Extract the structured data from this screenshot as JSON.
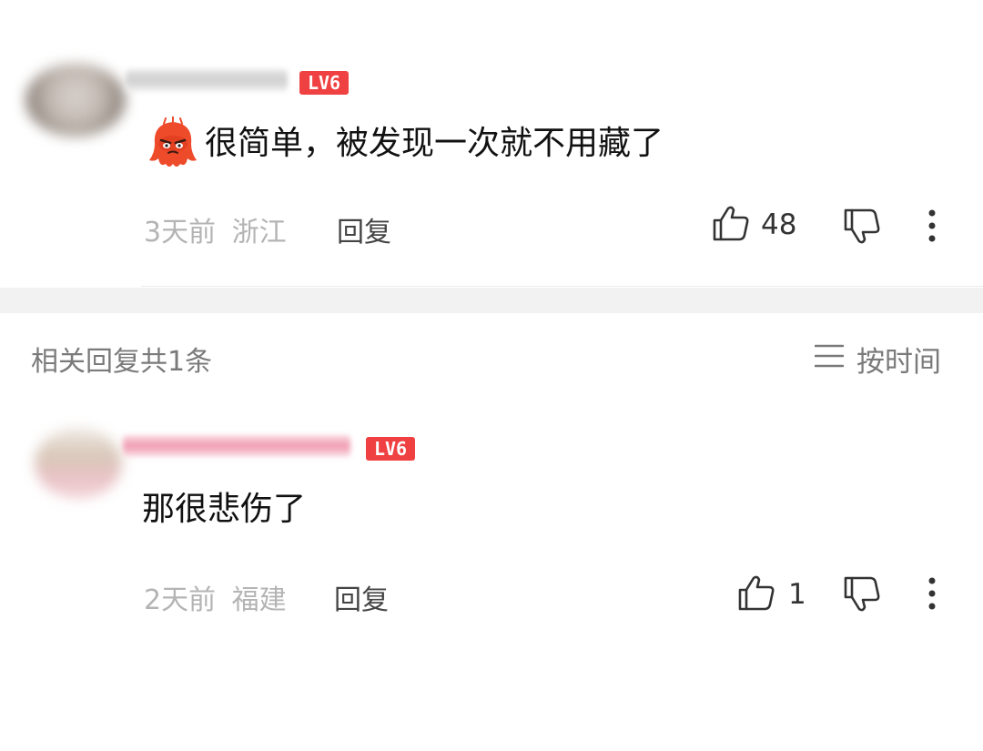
{
  "colors": {
    "badge": "#f04142",
    "meta": "#b4b4b4",
    "divider": "#f2f2f2"
  },
  "main_comment": {
    "level_badge": "LV6",
    "emoji_icon": "angry-octopus-emoji",
    "text": "很简单，被发现一次就不用藏了",
    "time": "3天前",
    "location": "浙江",
    "reply_label": "回复",
    "like_count": "48"
  },
  "replies_section": {
    "title": "相关回复共1条",
    "sort_label": "按时间"
  },
  "reply_comment": {
    "level_badge": "LV6",
    "text": "那很悲伤了",
    "time": "2天前",
    "location": "福建",
    "reply_label": "回复",
    "like_count": "1"
  }
}
